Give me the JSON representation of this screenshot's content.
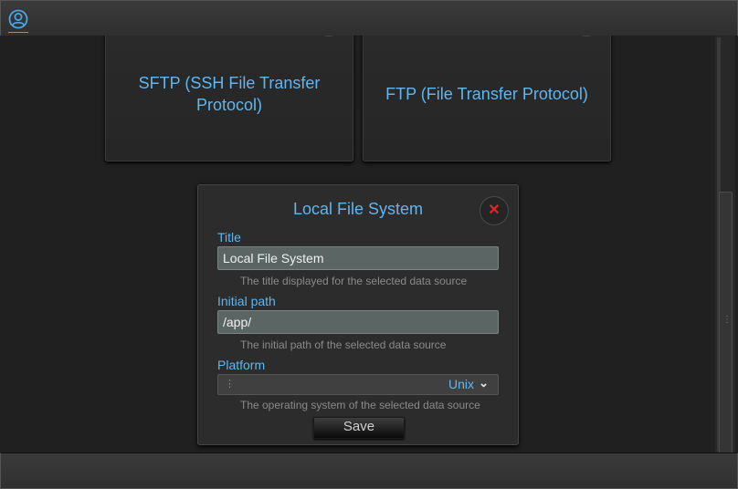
{
  "header": {
    "user_icon": "user-circle-icon"
  },
  "cards": [
    {
      "label": "SFTP (SSH File Transfer Protocol)"
    },
    {
      "label": "FTP (File Transfer Protocol)"
    }
  ],
  "dialog": {
    "title": "Local File System",
    "close_icon": "close-x-icon",
    "fields": {
      "title": {
        "label": "Title",
        "value": "Local File System",
        "hint": "The title displayed for the selected data source"
      },
      "initial_path": {
        "label": "Initial path",
        "value": "/app/",
        "hint": "The initial path of the selected data source"
      },
      "platform": {
        "label": "Platform",
        "value": "Unix",
        "hint": "The operating system of the selected data source"
      }
    },
    "save_label": "Save"
  },
  "colors": {
    "accent": "#5fb6f0",
    "close": "#e0262b",
    "background": "#202020",
    "field": "#5a6564"
  }
}
